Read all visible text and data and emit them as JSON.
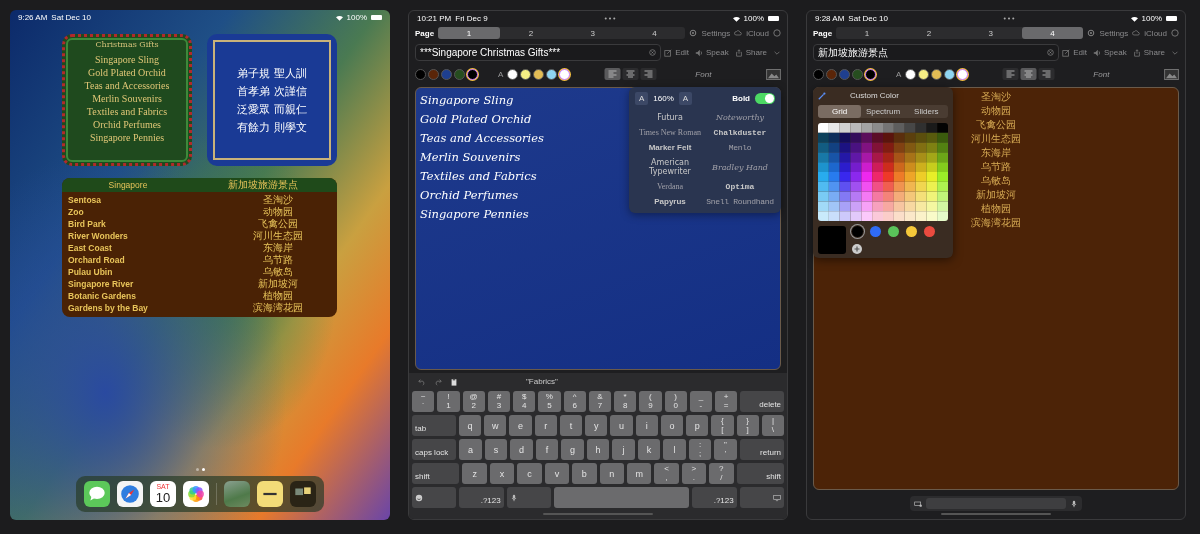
{
  "home_screen": {
    "status": {
      "time": "9:26 AM",
      "date": "Sat Dec 10",
      "battery": "100%"
    },
    "gift_widget": {
      "title": "Christmas Gifts",
      "items": [
        "Singapore Sling",
        "Gold Plated Orchid",
        "Teas and Accessories",
        "Merlin Souvenirs",
        "Textiles and Fabrics",
        "Orchid Perfumes",
        "Singapore Pennies"
      ]
    },
    "verse_widget": {
      "lines": [
        "弟子規 聖人訓",
        "首孝弟 次謹信",
        "泛愛眾 而親仁",
        "有餘力 則學文"
      ]
    },
    "table_widget": {
      "columns": [
        "Singapore",
        "新加坡旅游景点"
      ],
      "rows": [
        [
          "Sentosa",
          "圣淘沙"
        ],
        [
          "Zoo",
          "动物园"
        ],
        [
          "Bird Park",
          "飞禽公园"
        ],
        [
          "River Wonders",
          "河川生态园"
        ],
        [
          "East Coast",
          "东海岸"
        ],
        [
          "Orchard Road",
          "乌节路"
        ],
        [
          "Pulau Ubin",
          "乌敏岛"
        ],
        [
          "Singapore River",
          "新加坡河"
        ],
        [
          "Botanic Gardens",
          "植物园"
        ],
        [
          "Gardens by the Bay",
          "滨海湾花园"
        ]
      ]
    },
    "page_dots": [
      {
        "selected": false
      },
      {
        "selected": true
      }
    ],
    "dock": [
      {
        "kind": "messages"
      },
      {
        "kind": "safari"
      },
      {
        "kind": "calendar",
        "weekday": "SAT",
        "day": "10"
      },
      {
        "kind": "photos"
      },
      {
        "kind": "divider"
      },
      {
        "kind": "photo"
      },
      {
        "kind": "notes"
      },
      {
        "kind": "widgets"
      }
    ]
  },
  "editor_screens": [
    {
      "kind": "font_editor",
      "status": {
        "time": "10:21 PM",
        "date": "Fri Dec 9",
        "battery": "100%"
      },
      "page_label": "Page",
      "pages": [
        {
          "label": "1",
          "selected": true
        },
        {
          "label": "2",
          "selected": false
        },
        {
          "label": "3",
          "selected": false
        },
        {
          "label": "4",
          "selected": false
        }
      ],
      "settings": "Settings",
      "icloud": "iCloud",
      "title_field": {
        "value": "***Singapore Christmas Gifts***"
      },
      "actions": [
        {
          "kind": "edit",
          "label": "Edit"
        },
        {
          "kind": "speak",
          "label": "Speak"
        },
        {
          "kind": "share",
          "label": "Share"
        }
      ],
      "background_colors": [
        {
          "kind": "preset",
          "color": "#000000"
        },
        {
          "kind": "preset",
          "color": "#5a2508"
        },
        {
          "kind": "preset",
          "color": "#1e3f8f"
        },
        {
          "kind": "preset",
          "color": "#264d1f"
        },
        {
          "kind": "custom",
          "color": "#000000"
        }
      ],
      "text_color_label": "A",
      "text_colors": [
        {
          "kind": "preset",
          "color": "#ffffff"
        },
        {
          "kind": "preset",
          "color": "#f5ee85"
        },
        {
          "kind": "preset",
          "color": "#e3bd55"
        },
        {
          "kind": "preset",
          "color": "#8fd6f2"
        },
        {
          "kind": "custom",
          "color": "#ffffff"
        }
      ],
      "alignments": [
        {
          "kind": "left",
          "selected": true
        },
        {
          "kind": "center",
          "selected": false
        },
        {
          "kind": "right",
          "selected": false
        }
      ],
      "font_label": "Font",
      "document_lines": [
        "Singapore Sling",
        "Gold Plated Orchid",
        "Teas and Accessories",
        "Merlin Souvenirs",
        "Textiles and Fabrics",
        "Orchid Perfumes",
        "Singapore Pennies"
      ],
      "font_popover": {
        "smaller": "A",
        "size": "160%",
        "larger": "A",
        "bold_label": "Bold",
        "bold": true,
        "fonts": [
          "Futura",
          "Noteworthy",
          "Times New Roman",
          "Chalkduster",
          "Marker Felt",
          "Menlo",
          "American Typewriter",
          "Bradley Hand",
          "Verdana",
          "Optima",
          "Papyrus",
          "Snell Roundhand"
        ]
      },
      "keyboard": {
        "suggestion": "\"Fabrics\"",
        "rows": [
          {
            "keys": [
              {
                "kind": "char",
                "labels": [
                  "~",
                  "`"
                ]
              },
              {
                "kind": "char",
                "labels": [
                  "!",
                  "1"
                ]
              },
              {
                "kind": "char",
                "labels": [
                  "@",
                  "2"
                ]
              },
              {
                "kind": "char",
                "labels": [
                  "#",
                  "3"
                ]
              },
              {
                "kind": "char",
                "labels": [
                  "$",
                  "4"
                ]
              },
              {
                "kind": "char",
                "labels": [
                  "%",
                  "5"
                ]
              },
              {
                "kind": "char",
                "labels": [
                  "^",
                  "6"
                ]
              },
              {
                "kind": "char",
                "labels": [
                  "&",
                  "7"
                ]
              },
              {
                "kind": "char",
                "labels": [
                  "*",
                  "8"
                ]
              },
              {
                "kind": "char",
                "labels": [
                  "(",
                  "9"
                ]
              },
              {
                "kind": "char",
                "labels": [
                  ")",
                  "0"
                ]
              },
              {
                "kind": "char",
                "labels": [
                  "_",
                  "-"
                ]
              },
              {
                "kind": "char",
                "labels": [
                  "+",
                  "="
                ]
              },
              {
                "kind": "function",
                "label": "delete"
              }
            ]
          },
          {
            "keys": [
              {
                "kind": "function",
                "label": "tab"
              },
              {
                "kind": "char",
                "labels": [
                  "q"
                ]
              },
              {
                "kind": "char",
                "labels": [
                  "w"
                ]
              },
              {
                "kind": "char",
                "labels": [
                  "e"
                ]
              },
              {
                "kind": "char",
                "labels": [
                  "r"
                ]
              },
              {
                "kind": "char",
                "labels": [
                  "t"
                ]
              },
              {
                "kind": "char",
                "labels": [
                  "y"
                ]
              },
              {
                "kind": "char",
                "labels": [
                  "u"
                ]
              },
              {
                "kind": "char",
                "labels": [
                  "i"
                ]
              },
              {
                "kind": "char",
                "labels": [
                  "o"
                ]
              },
              {
                "kind": "char",
                "labels": [
                  "p"
                ]
              },
              {
                "kind": "char",
                "labels": [
                  "{",
                  "["
                ]
              },
              {
                "kind": "char",
                "labels": [
                  "}",
                  "]"
                ]
              },
              {
                "kind": "char",
                "labels": [
                  "|",
                  "\\"
                ]
              }
            ]
          },
          {
            "keys": [
              {
                "kind": "function",
                "label": "caps lock"
              },
              {
                "kind": "char",
                "labels": [
                  "a"
                ]
              },
              {
                "kind": "char",
                "labels": [
                  "s"
                ]
              },
              {
                "kind": "char",
                "labels": [
                  "d"
                ]
              },
              {
                "kind": "char",
                "labels": [
                  "f"
                ]
              },
              {
                "kind": "char",
                "labels": [
                  "g"
                ]
              },
              {
                "kind": "char",
                "labels": [
                  "h"
                ]
              },
              {
                "kind": "char",
                "labels": [
                  "j"
                ]
              },
              {
                "kind": "char",
                "labels": [
                  "k"
                ]
              },
              {
                "kind": "char",
                "labels": [
                  "l"
                ]
              },
              {
                "kind": "char",
                "labels": [
                  ":",
                  ";"
                ]
              },
              {
                "kind": "char",
                "labels": [
                  "\"",
                  "'"
                ]
              },
              {
                "kind": "function",
                "label": "return"
              }
            ]
          },
          {
            "keys": [
              {
                "kind": "function",
                "label": "shift"
              },
              {
                "kind": "char",
                "labels": [
                  "z"
                ]
              },
              {
                "kind": "char",
                "labels": [
                  "x"
                ]
              },
              {
                "kind": "char",
                "labels": [
                  "c"
                ]
              },
              {
                "kind": "char",
                "labels": [
                  "v"
                ]
              },
              {
                "kind": "char",
                "labels": [
                  "b"
                ]
              },
              {
                "kind": "char",
                "labels": [
                  "n"
                ]
              },
              {
                "kind": "char",
                "labels": [
                  "m"
                ]
              },
              {
                "kind": "char",
                "labels": [
                  "<",
                  ","
                ]
              },
              {
                "kind": "char",
                "labels": [
                  ">",
                  "."
                ]
              },
              {
                "kind": "char",
                "labels": [
                  "?",
                  "/"
                ]
              },
              {
                "kind": "function",
                "label": "shift"
              }
            ]
          },
          {
            "keys": [
              {
                "kind": "emoji"
              },
              {
                "kind": "function",
                "label": ".?123"
              },
              {
                "kind": "mic"
              },
              {
                "kind": "space"
              },
              {
                "kind": "function",
                "label": ".?123"
              },
              {
                "kind": "hide"
              }
            ]
          }
        ]
      }
    },
    {
      "kind": "color_editor",
      "status": {
        "time": "9:28 AM",
        "date": "Sat Dec 10",
        "battery": "100%"
      },
      "page_label": "Page",
      "pages": [
        {
          "label": "1",
          "selected": false
        },
        {
          "label": "2",
          "selected": false
        },
        {
          "label": "3",
          "selected": false
        },
        {
          "label": "4",
          "selected": true
        }
      ],
      "settings": "Settings",
      "icloud": "iCloud",
      "title_field": {
        "value": "新加坡旅游景点"
      },
      "actions": [
        {
          "kind": "edit",
          "label": "Edit"
        },
        {
          "kind": "speak",
          "label": "Speak"
        },
        {
          "kind": "share",
          "label": "Share"
        }
      ],
      "background_colors": [
        {
          "kind": "preset",
          "color": "#000000"
        },
        {
          "kind": "preset",
          "color": "#5a2508"
        },
        {
          "kind": "preset",
          "color": "#1e3f8f"
        },
        {
          "kind": "preset",
          "color": "#264d1f"
        },
        {
          "kind": "custom",
          "color": "#000000"
        }
      ],
      "text_color_label": "A",
      "text_colors": [
        {
          "kind": "preset",
          "color": "#ffffff"
        },
        {
          "kind": "preset",
          "color": "#f5ee85"
        },
        {
          "kind": "preset",
          "color": "#e3bd55"
        },
        {
          "kind": "preset",
          "color": "#8fd6f2"
        },
        {
          "kind": "custom",
          "color": "#ffffff"
        }
      ],
      "alignments": [
        {
          "kind": "left",
          "selected": false
        },
        {
          "kind": "center",
          "selected": true
        },
        {
          "kind": "right",
          "selected": false
        }
      ],
      "font_label": "Font",
      "document_lines": [
        "圣淘沙",
        "动物园",
        "飞禽公园",
        "河川生态园",
        "东海岸",
        "乌节路",
        "乌敏岛",
        "新加坡河",
        "植物园",
        "滨海湾花园"
      ],
      "color_popover": {
        "title": "Custom Color",
        "modes": [
          {
            "label": "Grid",
            "selected": true
          },
          {
            "label": "Spectrum",
            "selected": false
          },
          {
            "label": "Sliders",
            "selected": false
          }
        ],
        "current": {
          "color": "#000000"
        },
        "presets": [
          {
            "color": "#000000",
            "selected": true
          },
          {
            "color": "#2f6bf5",
            "selected": false
          },
          {
            "color": "#5ac35a",
            "selected": false
          },
          {
            "color": "#f5c83a",
            "selected": false
          },
          {
            "color": "#ea4b3f",
            "selected": false
          }
        ]
      }
    }
  ]
}
